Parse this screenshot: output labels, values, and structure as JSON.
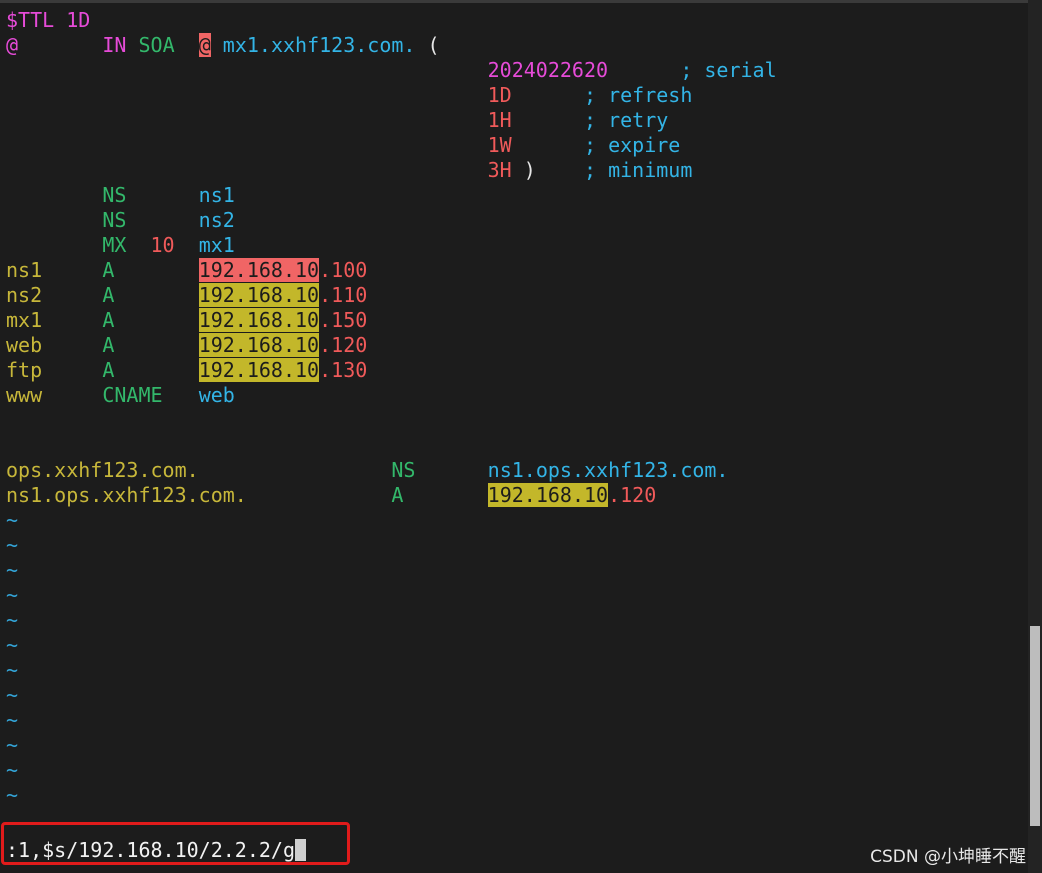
{
  "editor": {
    "lines": [
      [
        {
          "t": "$TTL 1D",
          "c": "c-magenta"
        }
      ],
      [
        {
          "t": "@",
          "c": "c-magenta"
        },
        {
          "t": "       "
        },
        {
          "t": "IN",
          "c": "c-magenta"
        },
        {
          "t": " "
        },
        {
          "t": "SOA",
          "c": "c-green"
        },
        {
          "t": "  "
        },
        {
          "t": "@",
          "c": "hl-at"
        },
        {
          "t": " "
        },
        {
          "t": "mx1.xxhf123.com.",
          "c": "c-cyan"
        },
        {
          "t": " (",
          "c": "c-white"
        }
      ],
      [
        {
          "t": "                                        "
        },
        {
          "t": "2024022620",
          "c": "c-magenta"
        },
        {
          "t": "      "
        },
        {
          "t": "; serial",
          "c": "c-cyan"
        }
      ],
      [
        {
          "t": "                                        "
        },
        {
          "t": "1D",
          "c": "c-red"
        },
        {
          "t": "      "
        },
        {
          "t": "; refresh",
          "c": "c-cyan"
        }
      ],
      [
        {
          "t": "                                        "
        },
        {
          "t": "1H",
          "c": "c-red"
        },
        {
          "t": "      "
        },
        {
          "t": "; retry",
          "c": "c-cyan"
        }
      ],
      [
        {
          "t": "                                        "
        },
        {
          "t": "1W",
          "c": "c-red"
        },
        {
          "t": "      "
        },
        {
          "t": "; expire",
          "c": "c-cyan"
        }
      ],
      [
        {
          "t": "                                        "
        },
        {
          "t": "3H",
          "c": "c-red"
        },
        {
          "t": " )",
          "c": "c-white"
        },
        {
          "t": "    "
        },
        {
          "t": "; minimum",
          "c": "c-cyan"
        }
      ],
      [
        {
          "t": "        "
        },
        {
          "t": "NS",
          "c": "c-green"
        },
        {
          "t": "      "
        },
        {
          "t": "ns1",
          "c": "c-cyan"
        }
      ],
      [
        {
          "t": "        "
        },
        {
          "t": "NS",
          "c": "c-green"
        },
        {
          "t": "      "
        },
        {
          "t": "ns2",
          "c": "c-cyan"
        }
      ],
      [
        {
          "t": "        "
        },
        {
          "t": "MX",
          "c": "c-green"
        },
        {
          "t": "  "
        },
        {
          "t": "10",
          "c": "c-red"
        },
        {
          "t": "  "
        },
        {
          "t": "mx1",
          "c": "c-cyan"
        }
      ],
      [
        {
          "t": "ns1",
          "c": "c-yellow"
        },
        {
          "t": "     "
        },
        {
          "t": "A",
          "c": "c-green"
        },
        {
          "t": "       "
        },
        {
          "t": "192.168.10",
          "c": "hl-cur"
        },
        {
          "t": ".100",
          "c": "c-red"
        }
      ],
      [
        {
          "t": "ns2",
          "c": "c-yellow"
        },
        {
          "t": "     "
        },
        {
          "t": "A",
          "c": "c-green"
        },
        {
          "t": "       "
        },
        {
          "t": "192.168.10",
          "c": "hl-match"
        },
        {
          "t": ".110",
          "c": "c-red"
        }
      ],
      [
        {
          "t": "mx1",
          "c": "c-yellow"
        },
        {
          "t": "     "
        },
        {
          "t": "A",
          "c": "c-green"
        },
        {
          "t": "       "
        },
        {
          "t": "192.168.10",
          "c": "hl-match"
        },
        {
          "t": ".150",
          "c": "c-red"
        }
      ],
      [
        {
          "t": "web",
          "c": "c-yellow"
        },
        {
          "t": "     "
        },
        {
          "t": "A",
          "c": "c-green"
        },
        {
          "t": "       "
        },
        {
          "t": "192.168.10",
          "c": "hl-match"
        },
        {
          "t": ".120",
          "c": "c-red"
        }
      ],
      [
        {
          "t": "ftp",
          "c": "c-yellow"
        },
        {
          "t": "     "
        },
        {
          "t": "A",
          "c": "c-green"
        },
        {
          "t": "       "
        },
        {
          "t": "192.168.10",
          "c": "hl-match"
        },
        {
          "t": ".130",
          "c": "c-red"
        }
      ],
      [
        {
          "t": "www",
          "c": "c-yellow"
        },
        {
          "t": "     "
        },
        {
          "t": "CNAME",
          "c": "c-green"
        },
        {
          "t": "   "
        },
        {
          "t": "web",
          "c": "c-cyan"
        }
      ],
      [],
      [],
      [
        {
          "t": "ops.xxhf123.com.",
          "c": "c-yellow"
        },
        {
          "t": "                "
        },
        {
          "t": "NS",
          "c": "c-green"
        },
        {
          "t": "      "
        },
        {
          "t": "ns1.ops.xxhf123.com.",
          "c": "c-cyan"
        }
      ],
      [
        {
          "t": "ns1.ops.xxhf123.com.",
          "c": "c-yellow"
        },
        {
          "t": "            "
        },
        {
          "t": "A",
          "c": "c-green"
        },
        {
          "t": "       "
        },
        {
          "t": "192.168.10",
          "c": "hl-match"
        },
        {
          "t": ".120",
          "c": "c-red"
        }
      ],
      [
        {
          "t": "~",
          "c": "c-tilde"
        }
      ],
      [
        {
          "t": "~",
          "c": "c-tilde"
        }
      ],
      [
        {
          "t": "~",
          "c": "c-tilde"
        }
      ],
      [
        {
          "t": "~",
          "c": "c-tilde"
        }
      ],
      [
        {
          "t": "~",
          "c": "c-tilde"
        }
      ],
      [
        {
          "t": "~",
          "c": "c-tilde"
        }
      ],
      [
        {
          "t": "~",
          "c": "c-tilde"
        }
      ],
      [
        {
          "t": "~",
          "c": "c-tilde"
        }
      ],
      [
        {
          "t": "~",
          "c": "c-tilde"
        }
      ],
      [
        {
          "t": "~",
          "c": "c-tilde"
        }
      ],
      [
        {
          "t": "~",
          "c": "c-tilde"
        }
      ],
      [
        {
          "t": "~",
          "c": "c-tilde"
        }
      ]
    ]
  },
  "command_line": {
    "text": ":1,$s/192.168.10/2.2.2/g"
  },
  "watermark": {
    "text": "CSDN @小坤睡不醒"
  },
  "colors": {
    "background": "#1c1c1c",
    "current_match_highlight": "#f06565",
    "match_highlight": "#c3b72a",
    "annotation_box": "#e01b1b"
  }
}
